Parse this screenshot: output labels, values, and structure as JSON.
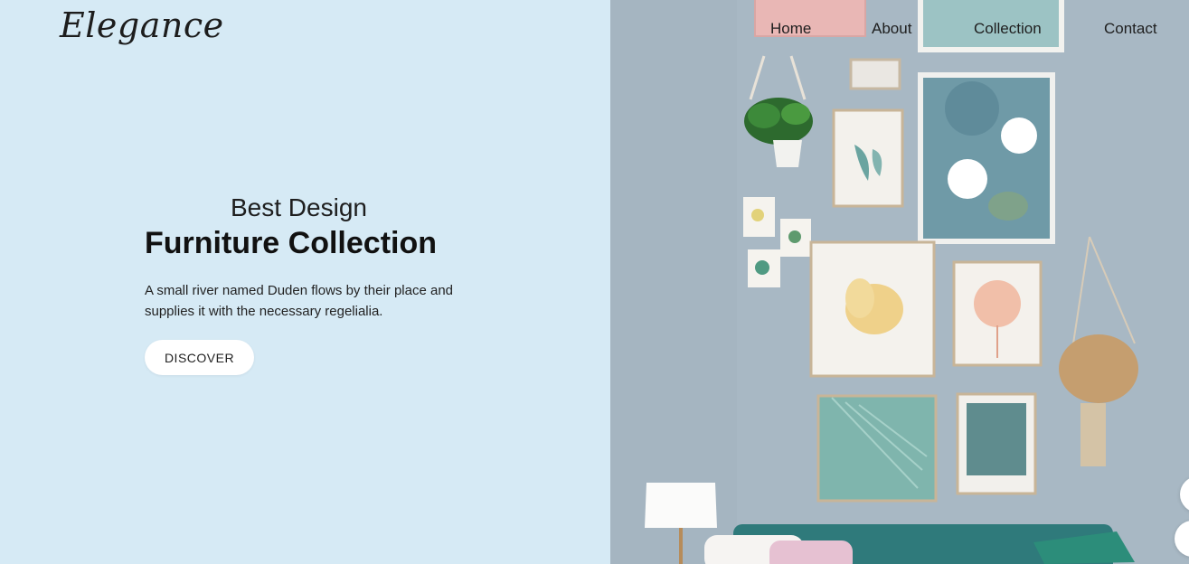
{
  "brand": {
    "logo_text": "Elegance"
  },
  "nav": {
    "items": [
      {
        "label": "Home"
      },
      {
        "label": "About"
      },
      {
        "label": "Collection"
      },
      {
        "label": "Contact"
      }
    ]
  },
  "hero": {
    "subtitle": "Best Design",
    "title": "Furniture Collection",
    "description": "A small river named Duden flows by their place and supplies it with the necessary regelialia.",
    "cta_label": "DISCOVER"
  },
  "colors": {
    "left_bg": "#d6eaf5",
    "wall": "#a9b9c5",
    "sofa": "#2f7a7b"
  }
}
